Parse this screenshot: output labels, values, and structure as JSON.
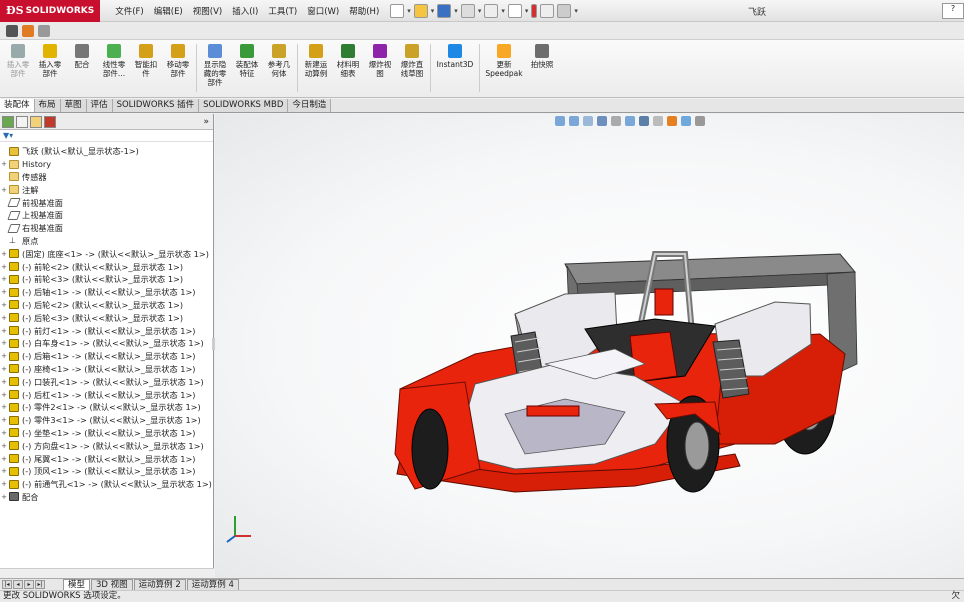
{
  "app": {
    "brand": "SOLIDWORKS",
    "window_title": "飞跃",
    "accent": "#c8102e"
  },
  "menu": [
    "文件(F)",
    "编辑(E)",
    "视图(V)",
    "插入(I)",
    "工具(T)",
    "窗口(W)",
    "帮助(H)"
  ],
  "ribbon": [
    {
      "label": "插入零部件",
      "icon": "insert-component-icon",
      "color": "#9aa",
      "disabled": true
    },
    {
      "label": "插入零部件",
      "icon": "insert-part-icon",
      "color": "#e0b400",
      "disabled": false
    },
    {
      "label": "配合",
      "icon": "mate-icon",
      "color": "#777",
      "disabled": false
    },
    {
      "label": "线性零部件...",
      "icon": "linear-pattern-icon",
      "color": "#4caf50",
      "disabled": false
    },
    {
      "label": "智能扣件",
      "icon": "smart-fastener-icon",
      "color": "#d4a017",
      "disabled": false
    },
    {
      "label": "移动零部件",
      "icon": "move-component-icon",
      "color": "#d4a017",
      "disabled": false
    },
    {
      "label": "显示隐藏的零部件",
      "icon": "show-hidden-icon",
      "color": "#5b8dd6",
      "disabled": false
    },
    {
      "label": "装配体特征",
      "icon": "assembly-feature-icon",
      "color": "#3a9a3a",
      "disabled": false
    },
    {
      "label": "参考几何体",
      "icon": "reference-geometry-icon",
      "color": "#c9a227",
      "disabled": false
    },
    {
      "label": "新建运动算例",
      "icon": "motion-study-icon",
      "color": "#d4a017",
      "disabled": false
    },
    {
      "label": "材料明细表",
      "icon": "bom-icon",
      "color": "#2e7d32",
      "disabled": false
    },
    {
      "label": "爆炸视图",
      "icon": "exploded-view-icon",
      "color": "#8e24aa",
      "disabled": false
    },
    {
      "label": "爆炸直线草图",
      "icon": "explode-line-icon",
      "color": "#c9a227",
      "disabled": false
    },
    {
      "label": "Instant3D",
      "icon": "instant3d-icon",
      "color": "#1e88e5",
      "disabled": false
    },
    {
      "label": "更新Speedpak",
      "icon": "speedpak-icon",
      "color": "#f9a825",
      "disabled": false
    },
    {
      "label": "拍快照",
      "icon": "snapshot-icon",
      "color": "#6d6d6d",
      "disabled": false
    }
  ],
  "command_tabs": [
    "装配体",
    "布局",
    "草图",
    "评估",
    "SOLIDWORKS 插件",
    "SOLIDWORKS MBD",
    "今日制造"
  ],
  "tree": [
    {
      "label": "飞跃  (默认<默认_显示状态-1>)",
      "icon": "asm",
      "exp": ""
    },
    {
      "label": "History",
      "icon": "fold",
      "exp": "+"
    },
    {
      "label": "传感器",
      "icon": "fold",
      "exp": ""
    },
    {
      "label": "注解",
      "icon": "fold",
      "exp": "+"
    },
    {
      "label": "前视基准面",
      "icon": "plane",
      "exp": ""
    },
    {
      "label": "上视基准面",
      "icon": "plane",
      "exp": ""
    },
    {
      "label": "右视基准面",
      "icon": "plane",
      "exp": ""
    },
    {
      "label": "原点",
      "icon": "origin",
      "exp": ""
    },
    {
      "label": "(固定) 底座<1> -> (默认<<默认>_显示状态 1>)",
      "icon": "part",
      "exp": "+"
    },
    {
      "label": "(-) 前轮<2> (默认<<默认>_显示状态 1>)",
      "icon": "part",
      "exp": "+"
    },
    {
      "label": "(-) 前轮<3> (默认<<默认>_显示状态 1>)",
      "icon": "part",
      "exp": "+"
    },
    {
      "label": "(-) 后轴<1> -> (默认<<默认>_显示状态 1>)",
      "icon": "part",
      "exp": "+"
    },
    {
      "label": "(-) 后轮<2> (默认<<默认>_显示状态 1>)",
      "icon": "part",
      "exp": "+"
    },
    {
      "label": "(-) 后轮<3> (默认<<默认>_显示状态 1>)",
      "icon": "part",
      "exp": "+"
    },
    {
      "label": "(-) 前灯<1> -> (默认<<默认>_显示状态 1>)",
      "icon": "part",
      "exp": "+"
    },
    {
      "label": "(-) 白车身<1> -> (默认<<默认>_显示状态 1>)",
      "icon": "part",
      "exp": "+"
    },
    {
      "label": "(-) 后箱<1> -> (默认<<默认>_显示状态 1>)",
      "icon": "part",
      "exp": "+"
    },
    {
      "label": "(-) 座椅<1> -> (默认<<默认>_显示状态 1>)",
      "icon": "part",
      "exp": "+"
    },
    {
      "label": "(-) 口装孔<1> -> (默认<<默认>_显示状态 1>)",
      "icon": "part",
      "exp": "+"
    },
    {
      "label": "(-) 后杠<1> -> (默认<<默认>_显示状态 1>)",
      "icon": "part",
      "exp": "+"
    },
    {
      "label": "(-) 零件2<1> -> (默认<<默认>_显示状态 1>)",
      "icon": "part",
      "exp": "+"
    },
    {
      "label": "(-) 零件3<1> -> (默认<<默认>_显示状态 1>)",
      "icon": "part",
      "exp": "+"
    },
    {
      "label": "(-) 坐垫<1> -> (默认<<默认>_显示状态 1>)",
      "icon": "part",
      "exp": "+"
    },
    {
      "label": "(-) 方向盘<1> -> (默认<<默认>_显示状态 1>)",
      "icon": "part",
      "exp": "+"
    },
    {
      "label": "(-) 尾翼<1> -> (默认<<默认>_显示状态 1>)",
      "icon": "part",
      "exp": "+"
    },
    {
      "label": "(-) 顶风<1> -> (默认<<默认>_显示状态 1>)",
      "icon": "part",
      "exp": "+"
    },
    {
      "label": "(-) 前通气孔<1> -> (默认<<默认>_显示状态 1>)",
      "icon": "part",
      "exp": "+"
    },
    {
      "label": "配合",
      "icon": "mate",
      "exp": "+"
    }
  ],
  "bottom_tabs": [
    "模型",
    "3D 视图",
    "运动算例 2",
    "运动算例 4"
  ],
  "status": {
    "left": "更改 SOLIDWORKS 选项设定。",
    "right": "欠"
  },
  "help_badge": "?"
}
